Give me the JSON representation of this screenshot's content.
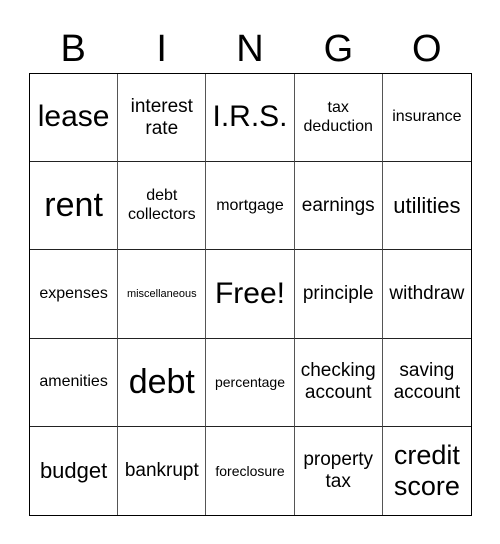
{
  "header": [
    "B",
    "I",
    "N",
    "G",
    "O"
  ],
  "cells": [
    [
      "lease",
      "interest rate",
      "I.R.S.",
      "tax deduction",
      "insurance"
    ],
    [
      "rent",
      "debt collectors",
      "mortgage",
      "earnings",
      "utilities"
    ],
    [
      "expenses",
      "miscellaneous",
      "Free!",
      "principle",
      "withdraw"
    ],
    [
      "amenities",
      "debt",
      "percentage",
      "checking account",
      "saving account"
    ],
    [
      "budget",
      "bankrupt",
      "foreclosure",
      "property tax",
      "credit score"
    ]
  ]
}
